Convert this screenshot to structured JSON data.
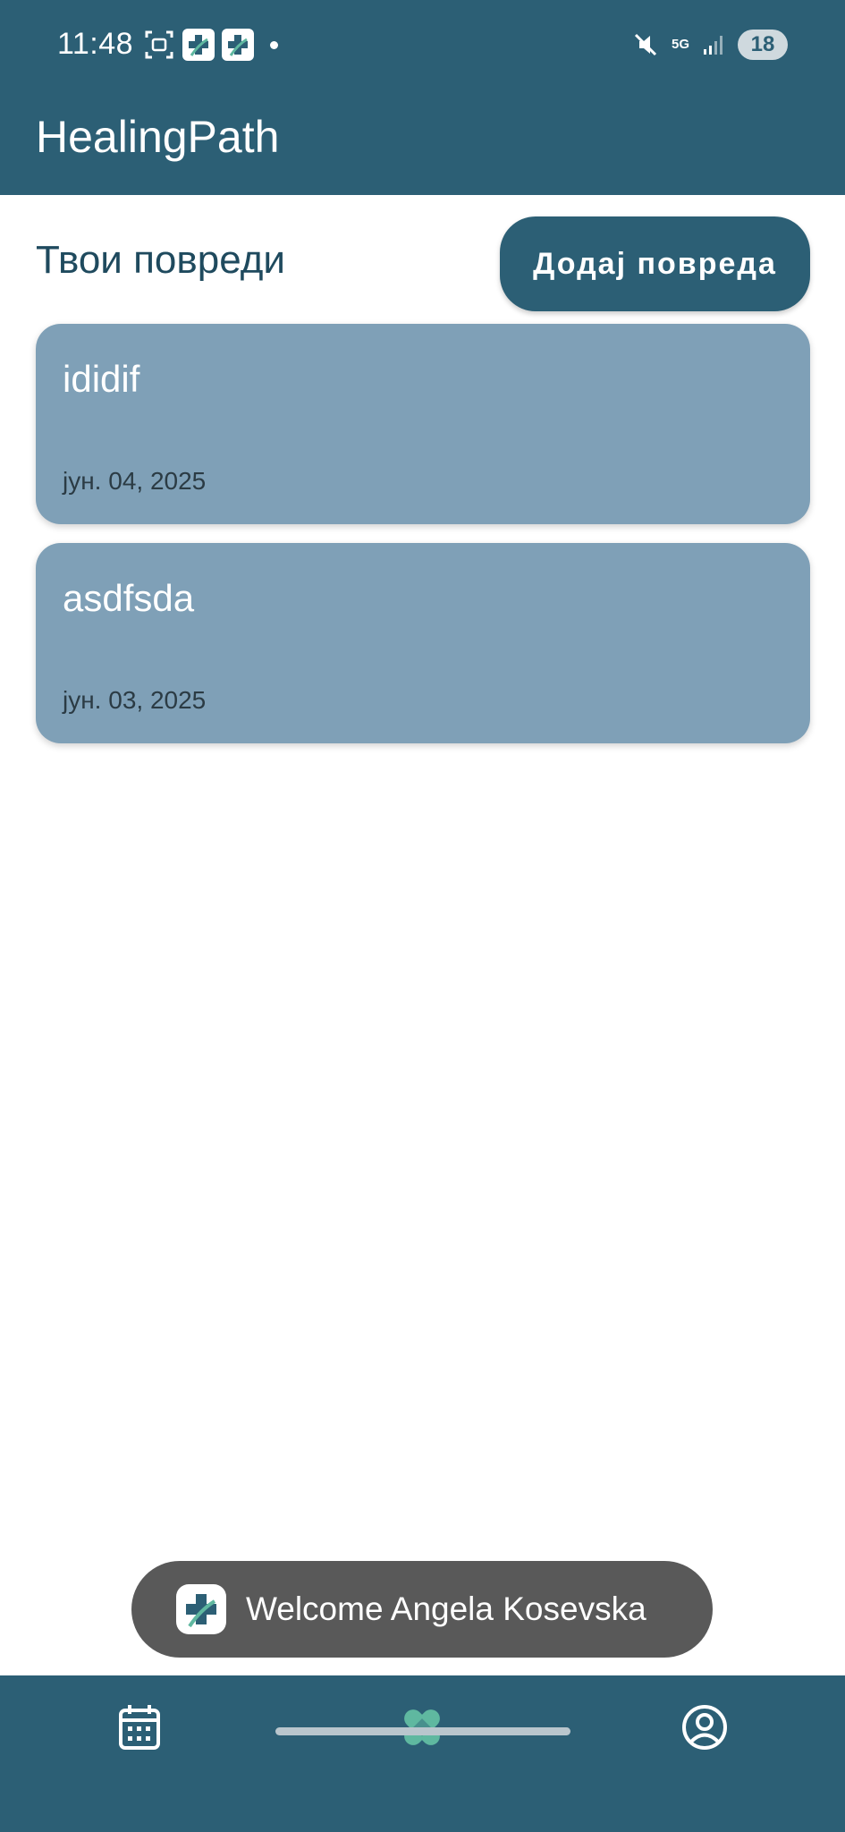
{
  "status_bar": {
    "time": "11:48",
    "network": "5G",
    "battery": "18"
  },
  "app": {
    "title": "HealingPath"
  },
  "main": {
    "section_title": "Твои повреди",
    "add_button_label": "Додај повреда",
    "injuries": [
      {
        "name": "ididif",
        "date": "јун. 04, 2025"
      },
      {
        "name": "asdfsda",
        "date": "јун. 03, 2025"
      }
    ]
  },
  "toast": {
    "message": "Welcome Angela Kosevska",
    "icon": "app-logo-icon"
  },
  "bottom_nav": {
    "items": [
      {
        "icon": "calendar-icon",
        "active": false
      },
      {
        "icon": "bandage-icon",
        "active": true
      },
      {
        "icon": "profile-icon",
        "active": false
      }
    ]
  },
  "colors": {
    "primary": "#2c5f75",
    "card": "#7fa0b7",
    "accent": "#5fb8a0",
    "toast": "#595959"
  }
}
